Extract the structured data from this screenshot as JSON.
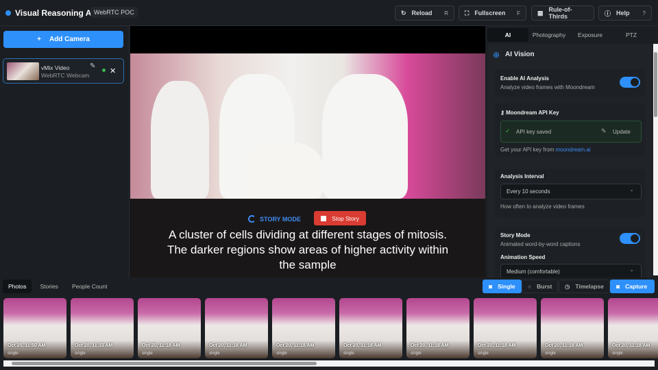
{
  "header": {
    "title": "Visual Reasoning AI™",
    "badge": "WebRTC POC",
    "buttons": [
      {
        "label": "Reload",
        "key": "R"
      },
      {
        "label": "Fullscreen",
        "key": "F"
      },
      {
        "label": "Rule-of-Thirds"
      },
      {
        "label": "Help",
        "key": "?"
      }
    ]
  },
  "sidebar": {
    "add_camera": "Add Camera",
    "camera": {
      "name": "vMix Video",
      "source": "WebRTC Webcam"
    }
  },
  "video": {
    "story_mode": "STORY MODE",
    "stop_story": "Stop Story",
    "caption": "A cluster of cells dividing at different stages of mitosis. The darker regions show areas of higher activity within the sample"
  },
  "right": {
    "tabs": [
      "AI",
      "Photography",
      "Exposure",
      "PTZ"
    ],
    "section_title": "AI Vision",
    "enable_label": "Enable AI Analysis",
    "enable_sub": "Analyze video frames with Moondream",
    "enable_on": true,
    "api_label": "Moondream API Key",
    "api_status": "API key saved",
    "api_update": "Update",
    "api_help": "Get your API key from ",
    "api_link": "moondream.ai",
    "interval_label": "Analysis Interval",
    "interval_value": "Every 10 seconds",
    "interval_help": "How often to analyze video frames",
    "story_label": "Story Mode",
    "story_sub": "Animated word-by-word captions",
    "story_on": true,
    "speed_label": "Animation Speed",
    "speed_value": "Medium (comfortable)"
  },
  "bottom": {
    "tabs": [
      "Photos",
      "Stories",
      "People Count"
    ],
    "modes": [
      "Single",
      "Burst",
      "Timelapse"
    ],
    "capture": "Capture",
    "photos": [
      {
        "time": "Oct 20, 11:50 AM",
        "type": "single"
      },
      {
        "time": "Oct 20, 11:33 AM",
        "type": "single"
      },
      {
        "time": "Oct 20, 11:18 AM",
        "type": "single"
      },
      {
        "time": "Oct 20, 11:18 AM",
        "type": "single"
      },
      {
        "time": "Oct 20, 11:18 AM",
        "type": "single"
      },
      {
        "time": "Oct 20, 11:18 AM",
        "type": "single"
      },
      {
        "time": "Oct 20, 11:18 AM",
        "type": "single"
      },
      {
        "time": "Oct 20, 11:18 AM",
        "type": "single"
      },
      {
        "time": "Oct 20, 11:18 AM",
        "type": "single"
      },
      {
        "time": "Oct 20, 11:18 AM",
        "type": "single"
      }
    ]
  }
}
